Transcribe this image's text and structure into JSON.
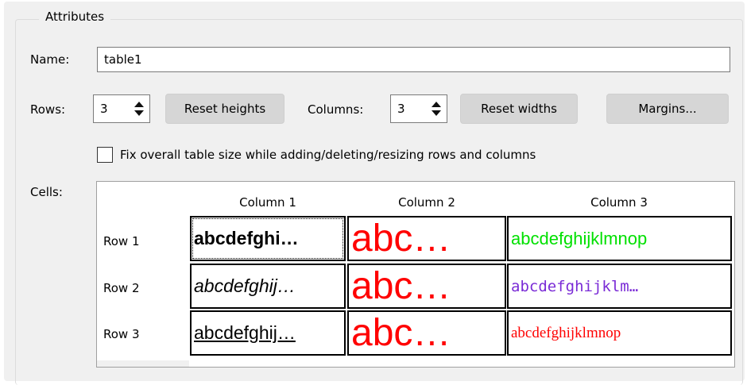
{
  "group": {
    "title": "Attributes"
  },
  "name": {
    "label": "Name:",
    "value": "table1"
  },
  "rows": {
    "label": "Rows:",
    "value": "3"
  },
  "columns": {
    "label": "Columns:",
    "value": "3"
  },
  "buttons": {
    "reset_heights": "Reset heights",
    "reset_widths": "Reset widths",
    "margins": "Margins..."
  },
  "fix_size": {
    "label": "Fix overall table size while adding/deleting/resizing rows and columns",
    "checked": false
  },
  "cells_label": "Cells:",
  "grid": {
    "column_headers": [
      "Column 1",
      "Column 2",
      "Column 3"
    ],
    "rows": [
      {
        "header": "Row 1",
        "cells": [
          "abcdefghi…",
          "abc…",
          "abcdefghijklmnop"
        ]
      },
      {
        "header": "Row 2",
        "cells": [
          "abcdefghij…",
          "abc…",
          "abcdefghijklm…"
        ]
      },
      {
        "header": "Row 3",
        "cells": [
          "abcdefghij…",
          "abc…",
          "abcdefghijklmnop"
        ]
      }
    ]
  },
  "colors": {
    "red": "#ff0000",
    "green": "#00e000",
    "purple": "#7a2bd6"
  }
}
